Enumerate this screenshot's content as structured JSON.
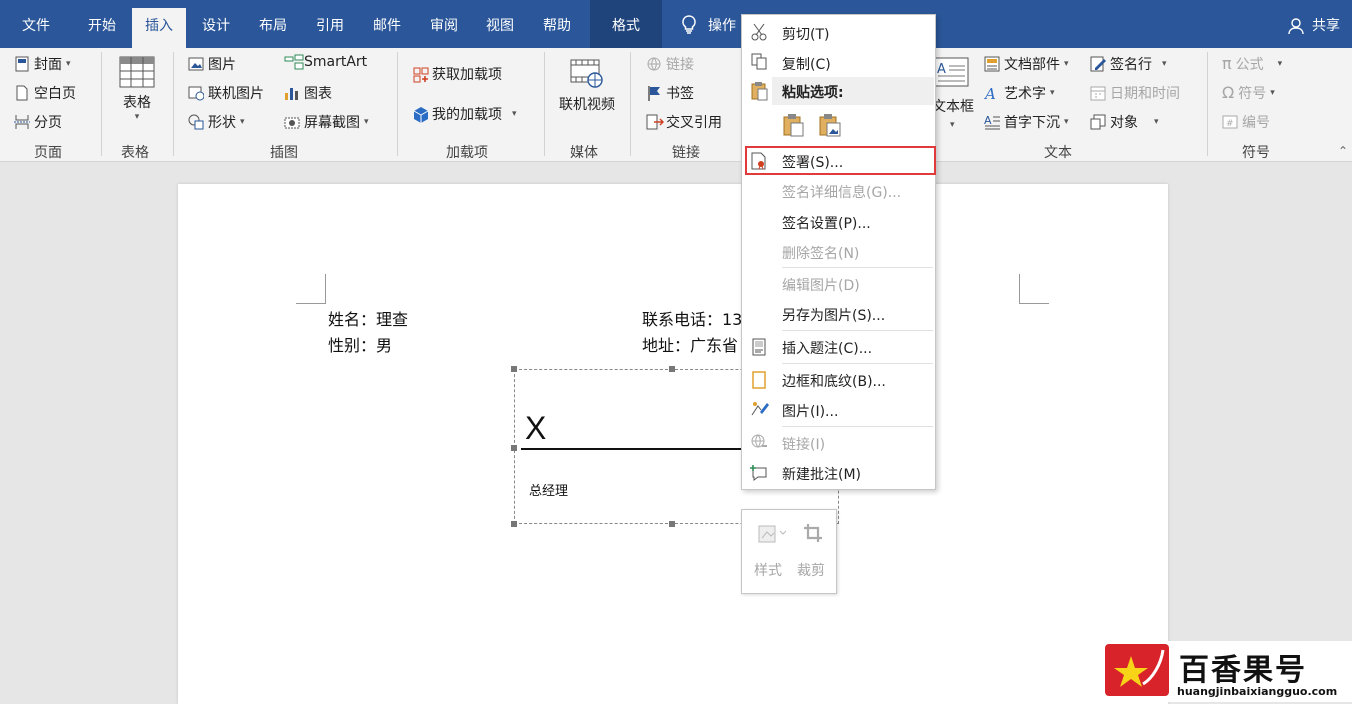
{
  "tabs": [
    "文件",
    "开始",
    "插入",
    "设计",
    "布局",
    "引用",
    "邮件",
    "审阅",
    "视图",
    "帮助",
    "格式",
    "操作"
  ],
  "share": "共享",
  "ribbon": {
    "page": {
      "cover": "封面",
      "blank": "空白页",
      "break": "分页",
      "group": "页面"
    },
    "table": {
      "label": "表格",
      "group": "表格"
    },
    "illus": {
      "pic": "图片",
      "online": "联机图片",
      "shapes": "形状",
      "smartart": "SmartArt",
      "chart": "图表",
      "screenshot": "屏幕截图",
      "group": "插图"
    },
    "addins": {
      "get": "获取加载项",
      "my": "我的加载项",
      "group": "加载项"
    },
    "media": {
      "video": "联机视频",
      "group": "媒体"
    },
    "links": {
      "link": "链接",
      "bookmark": "书签",
      "xref": "交叉引用",
      "group": "链接"
    },
    "text": {
      "textbox": "文本框",
      "parts": "文档部件",
      "wordart": "艺术字",
      "dropcap": "首字下沉",
      "sigline": "签名行",
      "datetime": "日期和时间",
      "object": "对象",
      "group": "文本"
    },
    "symbols": {
      "equation": "公式",
      "symbol": "符号",
      "number": "编号",
      "group": "符号"
    }
  },
  "doc": {
    "name": "姓名：理查",
    "gender": "性别：男",
    "phone": "联系电话：13",
    "address": "地址：广东省",
    "sig_x": "X",
    "sig_title": "总经理"
  },
  "menu": {
    "cut": "剪切(T)",
    "copy": "复制(C)",
    "paste_opts": "粘贴选项:",
    "sign": "签署(S)...",
    "sig_details": "签名详细信息(G)...",
    "sig_setup": "签名设置(P)...",
    "remove_sig": "删除签名(N)",
    "edit_pic": "编辑图片(D)",
    "save_pic": "另存为图片(S)...",
    "caption": "插入题注(C)...",
    "borders": "边框和底纹(B)...",
    "picture": "图片(I)...",
    "link": "链接(I)",
    "comment": "新建批注(M)"
  },
  "mini": {
    "style": "样式",
    "crop": "裁剪"
  },
  "watermark": {
    "brand": "百香果号",
    "url": "huangjinbaixiangguo.com"
  },
  "colors": {
    "accent": "#2b579a",
    "highlight": "#e03a3a"
  }
}
